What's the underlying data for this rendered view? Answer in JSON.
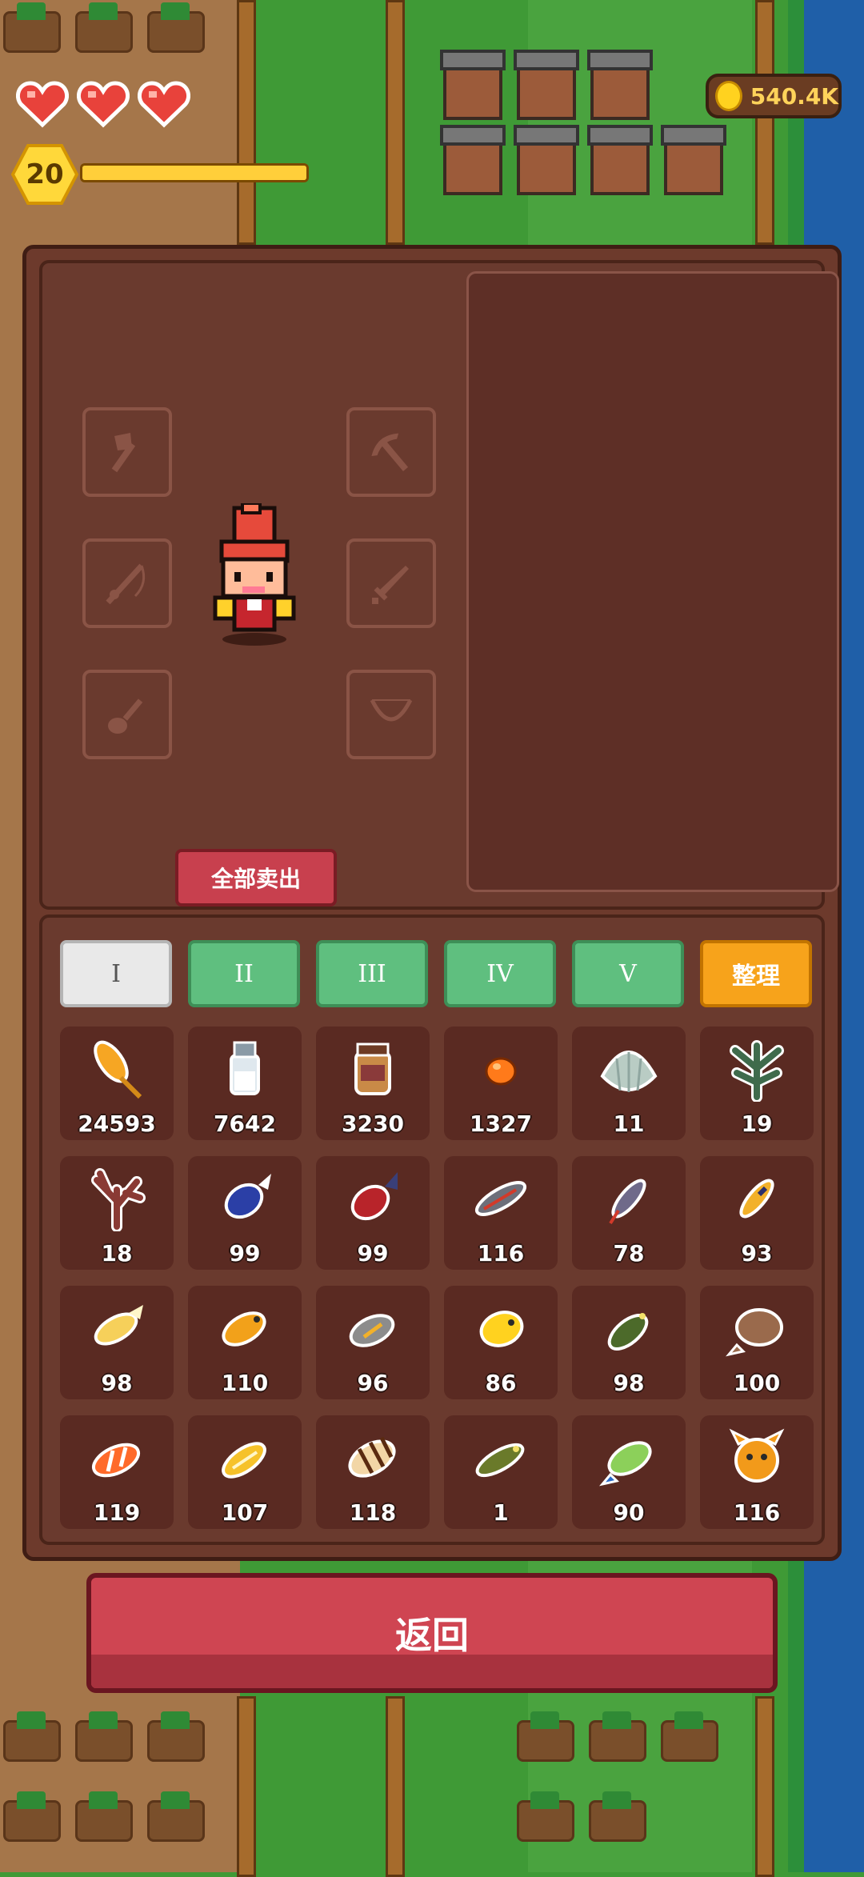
{
  "hud": {
    "hearts": [
      "heart-icon",
      "heart-icon",
      "heart-icon"
    ],
    "level": "20",
    "xp_progress": 1.0,
    "gold": "540.4K"
  },
  "equipment": {
    "slots": [
      "axe-icon",
      "pickaxe-icon",
      "fishing-rod-icon",
      "sword-icon",
      "shovel-icon",
      "bow-icon"
    ],
    "sell_all_label": "全部卖出"
  },
  "tabs": {
    "labels": [
      "I",
      "II",
      "III",
      "IV",
      "V"
    ],
    "active_index": 0,
    "sort_label": "整理"
  },
  "items": [
    {
      "icon": "wheat-icon",
      "count": "24593"
    },
    {
      "icon": "milk-bottle-icon",
      "count": "7642"
    },
    {
      "icon": "honey-jar-icon",
      "count": "3230"
    },
    {
      "icon": "orange-egg-icon",
      "count": "1327"
    },
    {
      "icon": "shell-icon",
      "count": "11"
    },
    {
      "icon": "seaweed-icon",
      "count": "19"
    },
    {
      "icon": "coral-icon",
      "count": "18"
    },
    {
      "icon": "blue-fish-icon",
      "count": "99"
    },
    {
      "icon": "red-fish-icon",
      "count": "99"
    },
    {
      "icon": "striped-fish-icon",
      "count": "116"
    },
    {
      "icon": "small-fish-icon",
      "count": "78"
    },
    {
      "icon": "yellow-fish-icon",
      "count": "93"
    },
    {
      "icon": "golden-fish-icon",
      "count": "98"
    },
    {
      "icon": "goldfish-icon",
      "count": "110"
    },
    {
      "icon": "gray-fish-icon",
      "count": "96"
    },
    {
      "icon": "yellow-puffer-icon",
      "count": "86"
    },
    {
      "icon": "green-fish-icon",
      "count": "98"
    },
    {
      "icon": "flatfish-icon",
      "count": "100"
    },
    {
      "icon": "clownfish-icon",
      "count": "119"
    },
    {
      "icon": "gold-koi-icon",
      "count": "107"
    },
    {
      "icon": "tiger-fish-icon",
      "count": "118"
    },
    {
      "icon": "olive-fish-icon",
      "count": "1"
    },
    {
      "icon": "tropical-fish-icon",
      "count": "90"
    },
    {
      "icon": "puffer-cat-icon",
      "count": "116"
    }
  ],
  "back_label": "返回",
  "colors": {
    "panel": "#6d3a2c",
    "tab_active": "#e9e9e9",
    "tab_normal": "#5fbf7f",
    "sort_button": "#f7a31b",
    "sell_button": "#c8404e",
    "back_button": "#cf4552",
    "gold_text": "#ffd35a"
  }
}
